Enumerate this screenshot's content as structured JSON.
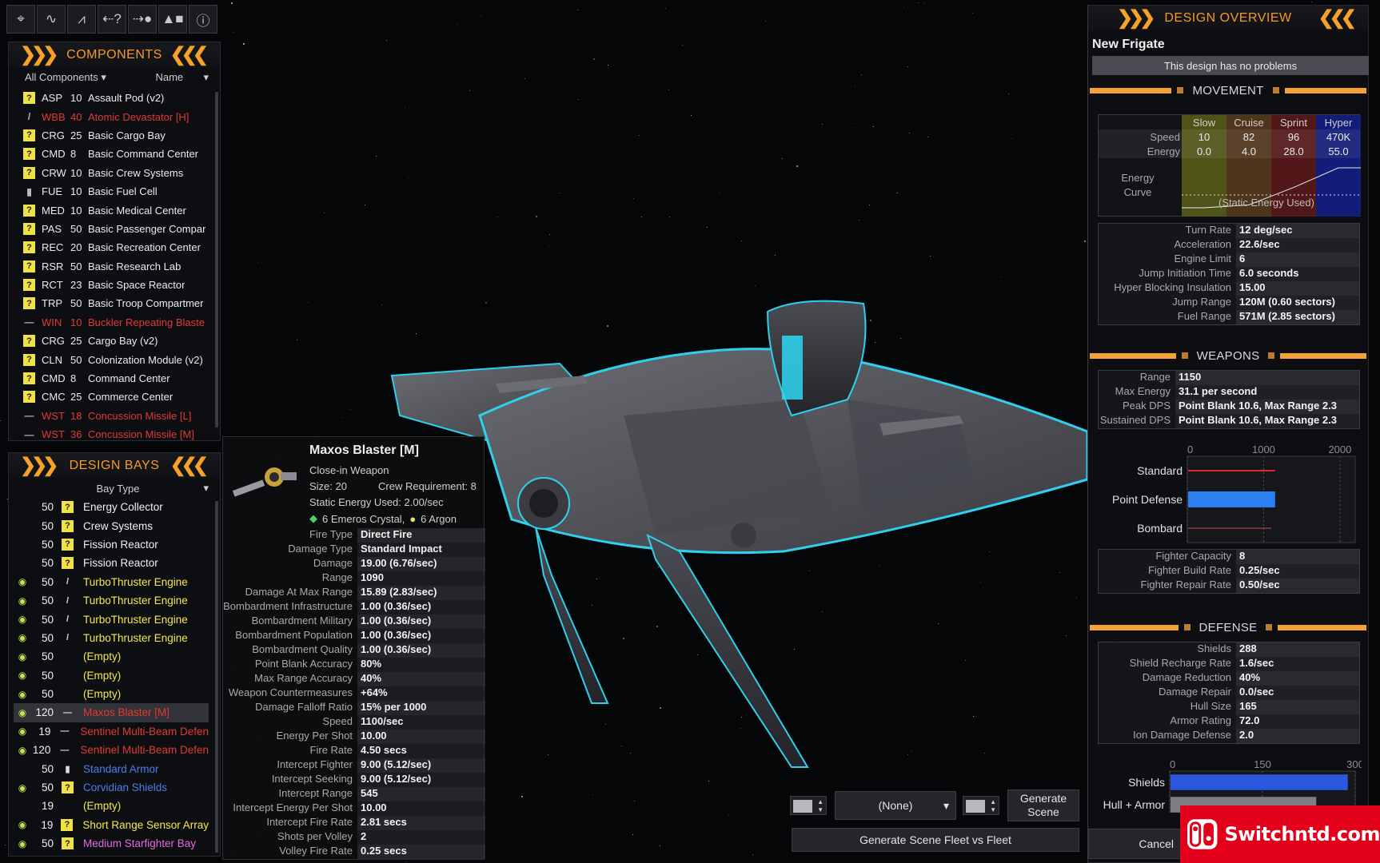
{
  "toolbar": {
    "tools": [
      {
        "name": "crosshair-icon",
        "glyph": "⌖"
      },
      {
        "name": "pulse-icon",
        "glyph": "∿"
      },
      {
        "name": "pulse-alt-icon",
        "glyph": "⩘"
      },
      {
        "name": "help-arrow-icon",
        "glyph": "⇠?"
      },
      {
        "name": "target-arrow-icon",
        "glyph": "⇢●"
      },
      {
        "name": "shapes-icon",
        "glyph": "▲■"
      },
      {
        "name": "info-icon",
        "glyph": "ⓘ"
      }
    ]
  },
  "components": {
    "title": "COMPONENTS",
    "filter": "All Components",
    "sort": "Name",
    "items": [
      {
        "code": "ASP",
        "size": "10",
        "name": "Assault Pod (v2)",
        "style": "normal",
        "icon": "?"
      },
      {
        "code": "WBB",
        "size": "40",
        "name": "Atomic Devastator [H]",
        "style": "red",
        "icon": "/"
      },
      {
        "code": "CRG",
        "size": "25",
        "name": "Basic Cargo Bay",
        "style": "normal",
        "icon": "?"
      },
      {
        "code": "CMD",
        "size": "8",
        "name": "Basic Command Center",
        "style": "normal",
        "icon": "?"
      },
      {
        "code": "CRW",
        "size": "10",
        "name": "Basic Crew Systems",
        "style": "normal",
        "icon": "?"
      },
      {
        "code": "FUE",
        "size": "10",
        "name": "Basic Fuel Cell",
        "style": "normal",
        "icon": "▮"
      },
      {
        "code": "MED",
        "size": "10",
        "name": "Basic Medical Center",
        "style": "normal",
        "icon": "?"
      },
      {
        "code": "PAS",
        "size": "50",
        "name": "Basic Passenger Compar",
        "style": "normal",
        "icon": "?"
      },
      {
        "code": "REC",
        "size": "20",
        "name": "Basic Recreation Center",
        "style": "normal",
        "icon": "?"
      },
      {
        "code": "RSR",
        "size": "50",
        "name": "Basic Research Lab",
        "style": "normal",
        "icon": "?"
      },
      {
        "code": "RCT",
        "size": "23",
        "name": "Basic Space Reactor",
        "style": "normal",
        "icon": "?"
      },
      {
        "code": "TRP",
        "size": "50",
        "name": "Basic Troop Compartmer",
        "style": "normal",
        "icon": "?"
      },
      {
        "code": "WIN",
        "size": "10",
        "name": "Buckler Repeating Blaste",
        "style": "red",
        "icon": "—"
      },
      {
        "code": "CRG",
        "size": "25",
        "name": "Cargo Bay (v2)",
        "style": "normal",
        "icon": "?"
      },
      {
        "code": "CLN",
        "size": "50",
        "name": "Colonization Module (v2)",
        "style": "normal",
        "icon": "?"
      },
      {
        "code": "CMD",
        "size": "8",
        "name": "Command Center",
        "style": "normal",
        "icon": "?"
      },
      {
        "code": "CMC",
        "size": "25",
        "name": "Commerce Center",
        "style": "normal",
        "icon": "?"
      },
      {
        "code": "WST",
        "size": "18",
        "name": "Concussion Missile [L]",
        "style": "red",
        "icon": "—"
      },
      {
        "code": "WST",
        "size": "36",
        "name": "Concussion Missile [M]",
        "style": "red",
        "icon": "—"
      }
    ]
  },
  "bays": {
    "title": "DESIGN BAYS",
    "filter": "Bay Type",
    "items": [
      {
        "eye": false,
        "size": "50",
        "icon": "?",
        "name": "Energy Collector",
        "color": "white"
      },
      {
        "eye": false,
        "size": "50",
        "icon": "?",
        "name": "Crew Systems",
        "color": "white"
      },
      {
        "eye": false,
        "size": "50",
        "icon": "?",
        "name": "Fission Reactor",
        "color": "white"
      },
      {
        "eye": false,
        "size": "50",
        "icon": "?",
        "name": "Fission Reactor",
        "color": "white"
      },
      {
        "eye": true,
        "size": "50",
        "icon": "/",
        "name": "TurboThruster Engine",
        "color": "yellow"
      },
      {
        "eye": true,
        "size": "50",
        "icon": "/",
        "name": "TurboThruster Engine",
        "color": "yellow"
      },
      {
        "eye": true,
        "size": "50",
        "icon": "/",
        "name": "TurboThruster Engine",
        "color": "yellow"
      },
      {
        "eye": true,
        "size": "50",
        "icon": "/",
        "name": "TurboThruster Engine",
        "color": "yellow"
      },
      {
        "eye": true,
        "size": "50",
        "icon": "",
        "name": "(Empty)",
        "color": "yellow"
      },
      {
        "eye": true,
        "size": "50",
        "icon": "",
        "name": "(Empty)",
        "color": "yellow"
      },
      {
        "eye": true,
        "size": "50",
        "icon": "",
        "name": "(Empty)",
        "color": "yellow"
      },
      {
        "eye": true,
        "size": "120",
        "icon": "—",
        "name": "Maxos Blaster [M]",
        "color": "red",
        "selected": true
      },
      {
        "eye": true,
        "size": "19",
        "icon": "—",
        "name": "Sentinel Multi-Beam Defen",
        "color": "red"
      },
      {
        "eye": true,
        "size": "120",
        "icon": "—",
        "name": "Sentinel Multi-Beam Defen",
        "color": "red"
      },
      {
        "eye": false,
        "size": "50",
        "icon": "▮",
        "name": "Standard Armor",
        "color": "blue"
      },
      {
        "eye": true,
        "size": "50",
        "icon": "?",
        "name": "Corvidian Shields",
        "color": "blue"
      },
      {
        "eye": false,
        "size": "19",
        "icon": "",
        "name": "(Empty)",
        "color": "yellow"
      },
      {
        "eye": true,
        "size": "19",
        "icon": "?",
        "name": "Short Range Sensor Array",
        "color": "yellow"
      },
      {
        "eye": true,
        "size": "50",
        "icon": "?",
        "name": "Medium Starfighter Bay",
        "color": "magenta"
      }
    ]
  },
  "tooltip": {
    "title": "Maxos Blaster [M]",
    "category": "Close-in Weapon",
    "size": "Size: 20",
    "crew": "Crew Requirement: 8",
    "static_energy": "Static Energy Used: 2.00/sec",
    "resource1": "6 Emeros Crystal,",
    "resource2": "6 Argon",
    "stats": [
      {
        "k": "Fire Type",
        "v": "Direct Fire"
      },
      {
        "k": "Damage Type",
        "v": "Standard Impact"
      },
      {
        "k": "Damage",
        "v": "19.00 (6.76/sec)"
      },
      {
        "k": "Range",
        "v": "1090"
      },
      {
        "k": "Damage At Max Range",
        "v": "15.89 (2.83/sec)"
      },
      {
        "k": "Bombardment Infrastructure",
        "v": "1.00 (0.36/sec)"
      },
      {
        "k": "Bombardment Military",
        "v": "1.00 (0.36/sec)"
      },
      {
        "k": "Bombardment Population",
        "v": "1.00 (0.36/sec)"
      },
      {
        "k": "Bombardment Quality",
        "v": "1.00 (0.36/sec)"
      },
      {
        "k": "Point Blank Accuracy",
        "v": "80%"
      },
      {
        "k": "Max Range Accuracy",
        "v": "40%"
      },
      {
        "k": "Weapon Countermeasures",
        "v": "+64%"
      },
      {
        "k": "Damage Falloff Ratio",
        "v": "15% per 1000"
      },
      {
        "k": "Speed",
        "v": "1100/sec"
      },
      {
        "k": "Energy Per Shot",
        "v": "10.00"
      },
      {
        "k": "Fire Rate",
        "v": "4.50 secs"
      },
      {
        "k": "Intercept Fighter",
        "v": "9.00 (5.12/sec)"
      },
      {
        "k": "Intercept Seeking",
        "v": "9.00 (5.12/sec)"
      },
      {
        "k": "Intercept Range",
        "v": "545"
      },
      {
        "k": "Intercept Energy Per Shot",
        "v": "10.00"
      },
      {
        "k": "Intercept Fire Rate",
        "v": "2.81 secs"
      },
      {
        "k": "Shots per Volley",
        "v": "2"
      },
      {
        "k": "Volley Fire Rate",
        "v": "0.25 secs"
      }
    ]
  },
  "overview": {
    "title": "DESIGN OVERVIEW",
    "design_name": "New Frigate",
    "problems": "This design has no problems",
    "movement": {
      "title": "MOVEMENT",
      "cols": [
        "Slow",
        "Cruise",
        "Sprint",
        "Hyper"
      ],
      "speed_label": "Speed",
      "energy_label": "Energy",
      "speed": [
        "10",
        "82",
        "96",
        "470K"
      ],
      "energy": [
        "0.0",
        "4.0",
        "28.0",
        "55.0"
      ],
      "curve_label": "Energy Curve",
      "curve_note": "(Static Energy Used)",
      "stats": [
        {
          "k": "Turn Rate",
          "v": "12 deg/sec"
        },
        {
          "k": "Acceleration",
          "v": "22.6/sec"
        },
        {
          "k": "Engine Limit",
          "v": "6"
        },
        {
          "k": "Jump Initiation Time",
          "v": "6.0 seconds"
        },
        {
          "k": "Hyper Blocking Insulation",
          "v": "15.00"
        },
        {
          "k": "Jump Range",
          "v": "120M (0.60 sectors)"
        },
        {
          "k": "Fuel Range",
          "v": "571M (2.85 sectors)"
        }
      ]
    },
    "weapons": {
      "title": "WEAPONS",
      "stats": [
        {
          "k": "Range",
          "v": "1150"
        },
        {
          "k": "Max Energy",
          "v": "31.1 per second"
        },
        {
          "k": "Peak DPS",
          "v": "Point Blank 10.6, Max Range 2.3"
        },
        {
          "k": "Sustained DPS",
          "v": "Point Blank 10.6, Max Range 2.3"
        }
      ],
      "fighters": [
        {
          "k": "Fighter Capacity",
          "v": "8"
        },
        {
          "k": "Fighter Build Rate",
          "v": "0.25/sec"
        },
        {
          "k": "Fighter Repair Rate",
          "v": "0.50/sec"
        }
      ]
    },
    "defense": {
      "title": "DEFENSE",
      "stats": [
        {
          "k": "Shields",
          "v": "288"
        },
        {
          "k": "Shield Recharge Rate",
          "v": "1.6/sec"
        },
        {
          "k": "Damage Reduction",
          "v": "40%"
        },
        {
          "k": "Damage Repair",
          "v": "0.0/sec"
        },
        {
          "k": "Hull Size",
          "v": "165"
        },
        {
          "k": "Armor Rating",
          "v": "72.0"
        },
        {
          "k": "Ion Damage Defense",
          "v": "2.0"
        }
      ]
    },
    "cancel": "Cancel"
  },
  "chart_data": [
    {
      "type": "bar",
      "categories": [
        "Standard",
        "Point Defense",
        "Bombard"
      ],
      "values": [
        1150,
        1150,
        1100
      ],
      "ticks": [
        "0",
        "1000",
        "2000"
      ],
      "xlim": [
        0,
        2200
      ],
      "colors": [
        "#e02a2a",
        "#2b7ff0",
        "#d84a4a"
      ],
      "bar_widths": [
        2,
        20,
        1
      ]
    },
    {
      "type": "bar",
      "categories": [
        "Shields",
        "Hull + Armor"
      ],
      "values": [
        288,
        237
      ],
      "ticks": [
        "0",
        "150",
        "300"
      ],
      "xlim": [
        0,
        300
      ],
      "colors": [
        "#2b57e0",
        "#7d7d84"
      ]
    }
  ],
  "scene": {
    "none_label": "(None)",
    "generate_label": "Generate Scene",
    "generate_fleet_label": "Generate Scene Fleet vs Fleet"
  },
  "watermark": {
    "text": "Switchntd.com",
    "color": "#e3001b"
  }
}
